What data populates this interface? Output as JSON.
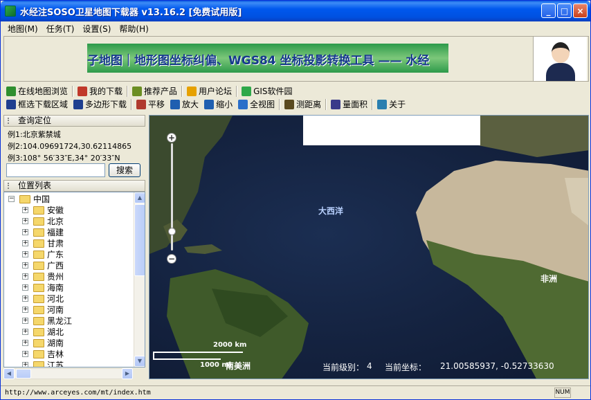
{
  "window": {
    "title": "水经注SOSO卫星地图下载器 v13.16.2 [免费试用版]",
    "controls": [
      "_",
      "□",
      "×"
    ]
  },
  "menu": [
    "地图(M)",
    "任务(T)",
    "设置(S)",
    "帮助(H)"
  ],
  "banner": {
    "text": "子地图｜地形图坐标纠偏、WGS84 坐标投影转换工具 —— 水经"
  },
  "toolbar1": [
    {
      "label": "在线地图浏览",
      "icon": "globe-icon",
      "color": "#2f8f2f"
    },
    {
      "label": "我的下载",
      "icon": "download-list-icon",
      "color": "#c0392b"
    },
    {
      "label": "推荐产品",
      "icon": "users-icon",
      "color": "#6b8e23"
    },
    {
      "label": "用户论坛",
      "icon": "forum-icon",
      "color": "#e6a100"
    },
    {
      "label": "GIS软件园",
      "icon": "gis-icon",
      "color": "#2ea84a"
    }
  ],
  "toolbar2": [
    {
      "label": "框选下载区域",
      "icon": "rect-select-icon",
      "color": "#1f3f8f"
    },
    {
      "label": "多边形下载",
      "icon": "polygon-icon",
      "color": "#1f3f8f"
    },
    {
      "label": "平移",
      "icon": "pan-icon",
      "color": "#b03a2e"
    },
    {
      "label": "放大",
      "icon": "zoom-in-icon",
      "color": "#1f5fb0"
    },
    {
      "label": "缩小",
      "icon": "zoom-out-icon",
      "color": "#1f5fb0"
    },
    {
      "label": "全视图",
      "icon": "full-extent-icon",
      "color": "#2a6fc9"
    },
    {
      "label": "测距离",
      "icon": "ruler-icon",
      "color": "#5a4a1f"
    },
    {
      "label": "量面积",
      "icon": "area-icon",
      "color": "#3a3a8a"
    },
    {
      "label": "关于",
      "icon": "about-icon",
      "color": "#2a7fb0"
    }
  ],
  "query": {
    "title": "查询定位",
    "examples": [
      "例1:北京紫禁城",
      "例2:104.09691724,30.62114865",
      "例3:108° 56′33″E,34° 20′33″N"
    ],
    "input_value": "",
    "search_label": "搜索"
  },
  "location_list": {
    "title": "位置列表",
    "root": "中国",
    "provinces": [
      "安徽",
      "北京",
      "福建",
      "甘肃",
      "广东",
      "广西",
      "贵州",
      "海南",
      "河北",
      "河南",
      "黑龙江",
      "湖北",
      "湖南",
      "吉林",
      "江苏"
    ]
  },
  "map": {
    "labels": {
      "atlantic": "大西洋",
      "africa": "非洲",
      "south_america": "南美洲"
    },
    "scale_top": "2000 km",
    "scale_bottom": "1000 mi",
    "zoom_level_label": "当前级别：",
    "zoom_level": "4",
    "coords_label": "当前坐标：",
    "coords": "21.00585937, -0.52733630"
  },
  "status": {
    "url": "http://www.arceyes.com/mt/index.htm",
    "num": "NUM"
  }
}
